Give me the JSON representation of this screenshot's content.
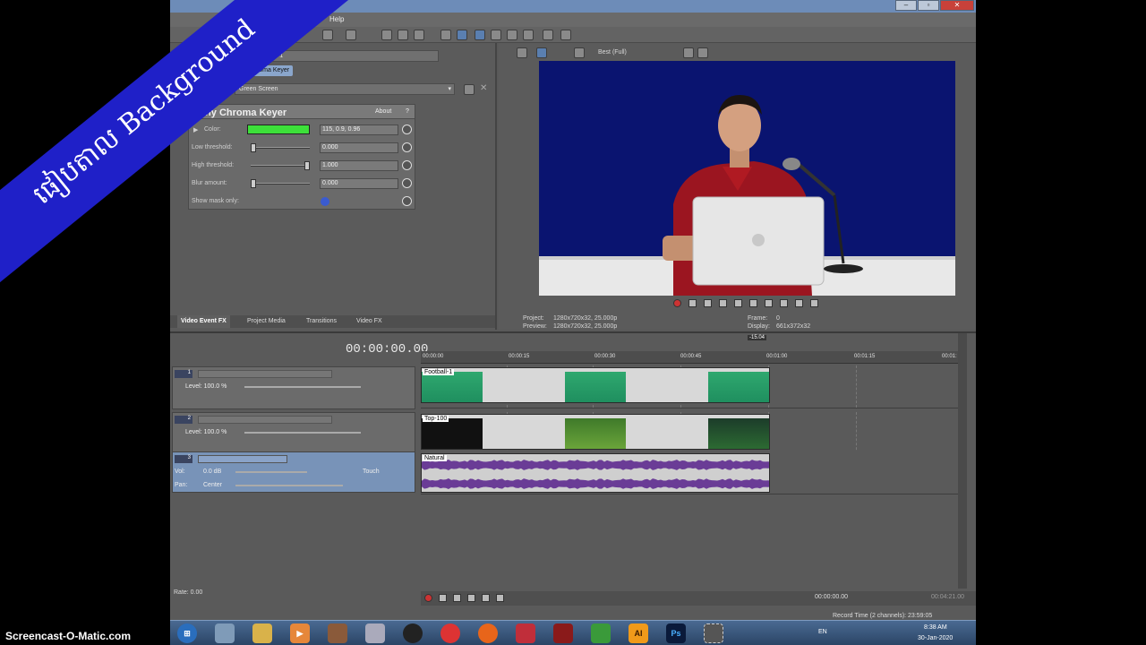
{
  "window": {
    "menu_visible": "Help"
  },
  "fx_pane": {
    "chain_source": "Football-1",
    "chain_item": "Chroma Keyer",
    "preset": "Green Screen",
    "plugin_title": "Sony Chroma Keyer",
    "about": "About",
    "help": "?",
    "params": {
      "color_label": "Color:",
      "color_value": "115, 0.9, 0.96",
      "low_label": "Low threshold:",
      "low_value": "0.000",
      "high_label": "High threshold:",
      "high_value": "1.000",
      "blur_label": "Blur amount:",
      "blur_value": "0.000",
      "mask_label": "Show mask only:"
    },
    "tabs": [
      "Video Event FX",
      "Project Media",
      "Transitions",
      "Video FX"
    ]
  },
  "preview": {
    "quality": "Best (Full)",
    "project_label": "Project:",
    "project_value": "1280x720x32, 25.000p",
    "preview_label": "Preview:",
    "preview_value": "1280x720x32, 25.000p",
    "frame_label": "Frame:",
    "frame_value": "0",
    "display_label": "Display:",
    "display_value": "661x372x32"
  },
  "timeline": {
    "timecode": "00:00:00.00",
    "ruler": [
      "00:00:00",
      "00:00:15",
      "00:00:30",
      "00:00:45",
      "00:01:00",
      "00:01:15",
      "00:01:"
    ],
    "marker": "-15.04",
    "tracks": [
      {
        "num": "1",
        "level_label": "Level: 100.0 %",
        "clip": "Football-1"
      },
      {
        "num": "2",
        "level_label": "Level: 100.0 %",
        "clip": "Top-100"
      },
      {
        "num": "3",
        "vol_label": "Vol:",
        "vol_value": "0.0 dB",
        "pan_label": "Pan:",
        "pan_value": "Center",
        "touch": "Touch",
        "clip": "Natural"
      }
    ],
    "rate": "Rate: 0.00",
    "play_time": "00:00:00.00",
    "end_time": "00:04:21.00",
    "record_time": "Record Time (2 channels): 23:59:05"
  },
  "banner": {
    "text": "ផៀបតាល Background"
  },
  "watermark": "Screencast-O-Matic.com",
  "taskbar": {
    "lang": "EN",
    "time": "8:38 AM",
    "date": "30-Jan-2020",
    "apps": [
      "AI",
      "Ps"
    ]
  },
  "colors": {
    "key_color": "#3de03a",
    "banner": "#1f20c8",
    "video_bg": "#0a1470"
  }
}
